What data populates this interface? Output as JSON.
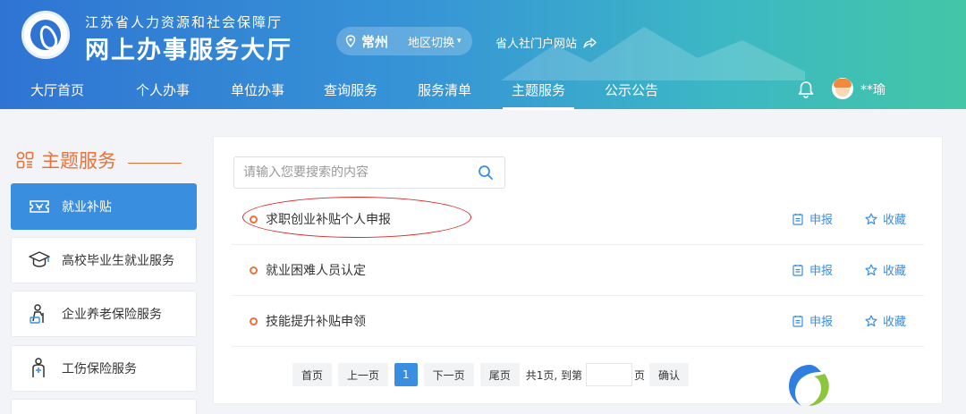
{
  "header": {
    "subtitle": "江苏省人力资源和社会保障厅",
    "title": "网上办事服务大厅",
    "region": {
      "city": "常州",
      "switch_label": "地区切换",
      "caret": "▾"
    },
    "portal_link": "省人社门户网站"
  },
  "nav": {
    "items": [
      {
        "label": "大厅首页"
      },
      {
        "label": "个人办事"
      },
      {
        "label": "单位办事"
      },
      {
        "label": "查询服务"
      },
      {
        "label": "服务清单"
      },
      {
        "label": "主题服务"
      },
      {
        "label": "公示公告"
      }
    ],
    "active_index": 5,
    "username": "**瑜"
  },
  "sidebar": {
    "title": "主题服务",
    "items": [
      {
        "label": "就业补贴",
        "icon": "ticket-icon",
        "active": true
      },
      {
        "label": "高校毕业生就业服务",
        "icon": "graduation-cap-icon",
        "active": false
      },
      {
        "label": "企业养老保险服务",
        "icon": "pension-icon",
        "active": false
      },
      {
        "label": "工伤保险服务",
        "icon": "injury-insurance-icon",
        "active": false
      }
    ]
  },
  "search": {
    "placeholder": "请输入您要搜索的内容"
  },
  "services": [
    {
      "name": "求职创业补贴个人申报",
      "apply_label": "申报",
      "fav_label": "收藏",
      "highlighted": true
    },
    {
      "name": "就业困难人员认定",
      "apply_label": "申报",
      "fav_label": "收藏",
      "highlighted": false
    },
    {
      "name": "技能提升补贴申领",
      "apply_label": "申报",
      "fav_label": "收藏",
      "highlighted": false
    }
  ],
  "pagination": {
    "first": "首页",
    "prev": "上一页",
    "current": "1",
    "next": "下一页",
    "last": "尾页",
    "summary": "共1页, 到第",
    "page_unit": "页",
    "confirm": "确认"
  },
  "colors": {
    "accent_blue": "#3a8ee0",
    "accent_orange": "#e8733a",
    "highlight_red": "#d9262a"
  }
}
